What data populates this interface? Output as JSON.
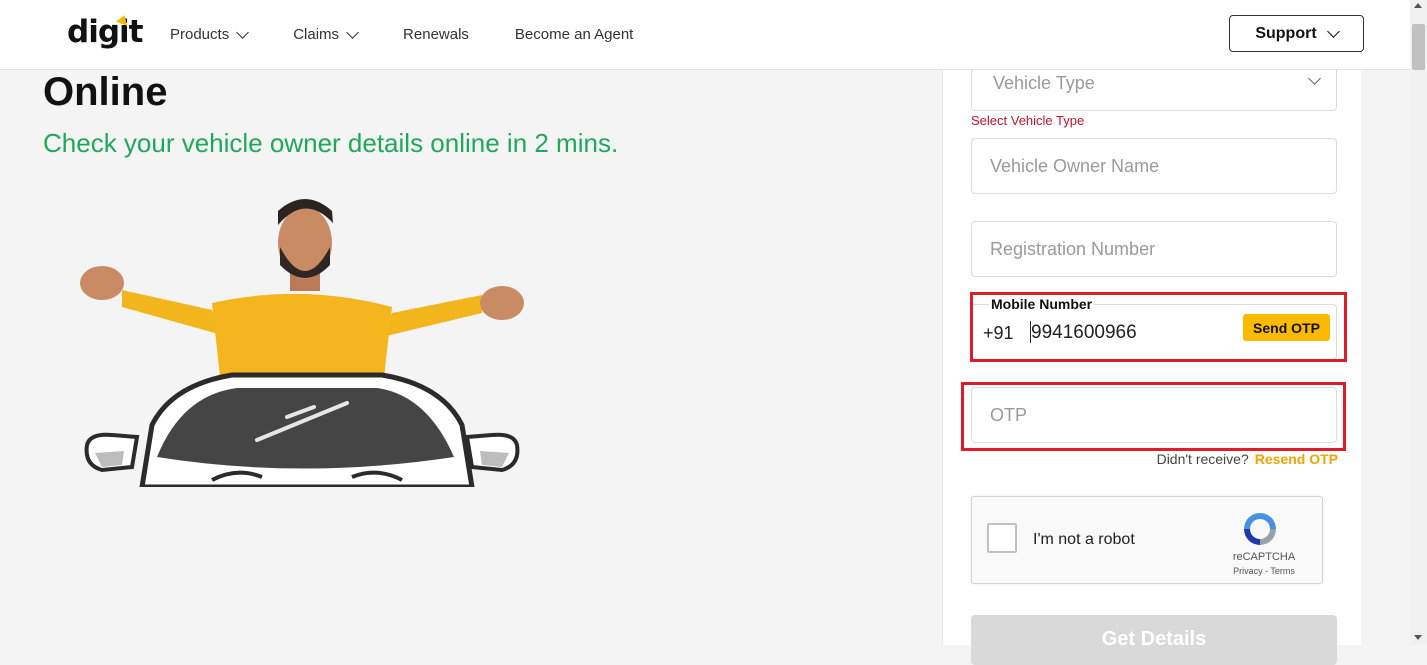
{
  "header": {
    "logo": "digit",
    "nav": [
      {
        "label": "Products",
        "dropdown": true
      },
      {
        "label": "Claims",
        "dropdown": true
      },
      {
        "label": "Renewals",
        "dropdown": false
      },
      {
        "label": "Become an Agent",
        "dropdown": false
      }
    ],
    "support_label": "Support"
  },
  "hero": {
    "title": "Online",
    "subtitle": "Check your vehicle owner details online in 2 mins."
  },
  "form": {
    "vehicle_type_placeholder": "Vehicle Type",
    "vehicle_type_error": "Select Vehicle Type",
    "owner_name_placeholder": "Vehicle Owner Name",
    "registration_placeholder": "Registration Number",
    "mobile_label": "Mobile Number",
    "mobile_prefix": "+91",
    "mobile_value": "9941600966",
    "send_otp_label": "Send OTP",
    "otp_placeholder": "OTP",
    "resend_prompt": "Didn't receive?",
    "resend_label": "Resend OTP",
    "captcha_label": "I'm not a robot",
    "captcha_brand": "reCAPTCHA",
    "captcha_links": "Privacy - Terms",
    "submit_label": "Get Details"
  },
  "colors": {
    "accent_yellow": "#fbb900",
    "green_text": "#1fa85b",
    "error_red": "#c8102e",
    "highlight_red": "#e01b2a"
  }
}
